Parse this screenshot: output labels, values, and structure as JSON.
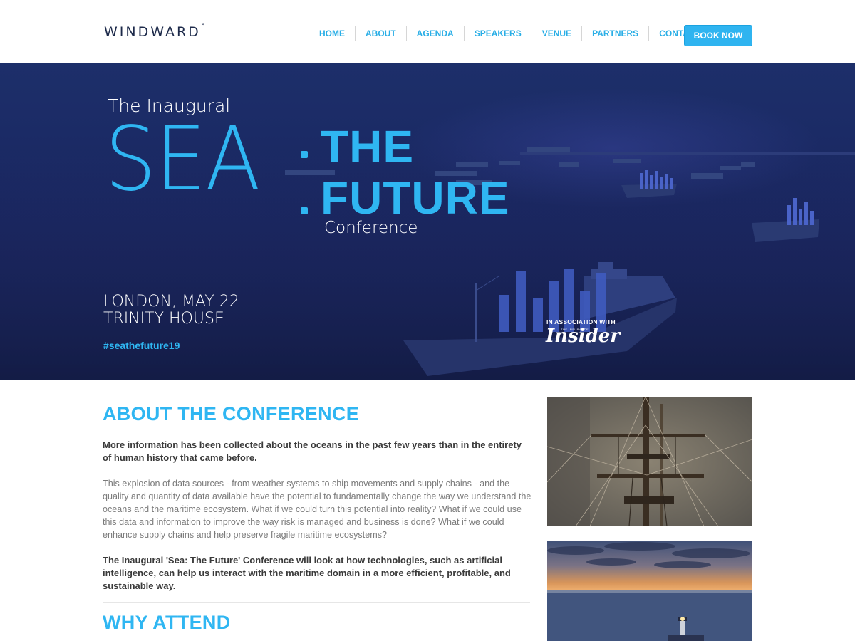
{
  "header": {
    "logo": "WINDWARD",
    "logo_mark": "°",
    "nav": [
      "HOME",
      "ABOUT",
      "AGENDA",
      "SPEAKERS",
      "VENUE",
      "PARTNERS",
      "CONTACT"
    ],
    "book_label": "BOOK NOW"
  },
  "hero": {
    "pre_title": "The Inaugural",
    "sea": "SEA",
    "the": "THE",
    "future": "FUTURE",
    "conference": "Conference",
    "date_line1": "LONDON, MAY 22",
    "date_line2": "TRINITY HOUSE",
    "hashtag": "#seathefuture19",
    "association": "IN ASSOCIATION WITH",
    "partner_small": "THE INSURANCE",
    "partner_logo": "Insider"
  },
  "about": {
    "heading": "ABOUT THE CONFERENCE",
    "lead": "More information has been collected about the oceans in the past few years than in the entirety of human history that came before.",
    "body": "This explosion of data sources - from weather systems to ship movements and supply chains - and the quality and quantity of data available have the potential to fundamentally change the way we understand the oceans and the maritime ecosystem. What if we could turn this potential into reality? What if we could use this data and information to improve the way risk is managed and business is done? What if we could enhance supply chains and help preserve fragile maritime ecosystems?",
    "lead2": "The Inaugural 'Sea: The Future' Conference will look at how technologies, such as artificial intelligence, can help us interact with the maritime domain in a more efficient, profitable, and sustainable way."
  },
  "why": {
    "heading": "WHY ATTEND"
  },
  "colors": {
    "accent": "#2fb6f2",
    "hero_bg": "#1a2760",
    "text_dark": "#3a3a3a",
    "text_body": "#7b7b7b"
  }
}
